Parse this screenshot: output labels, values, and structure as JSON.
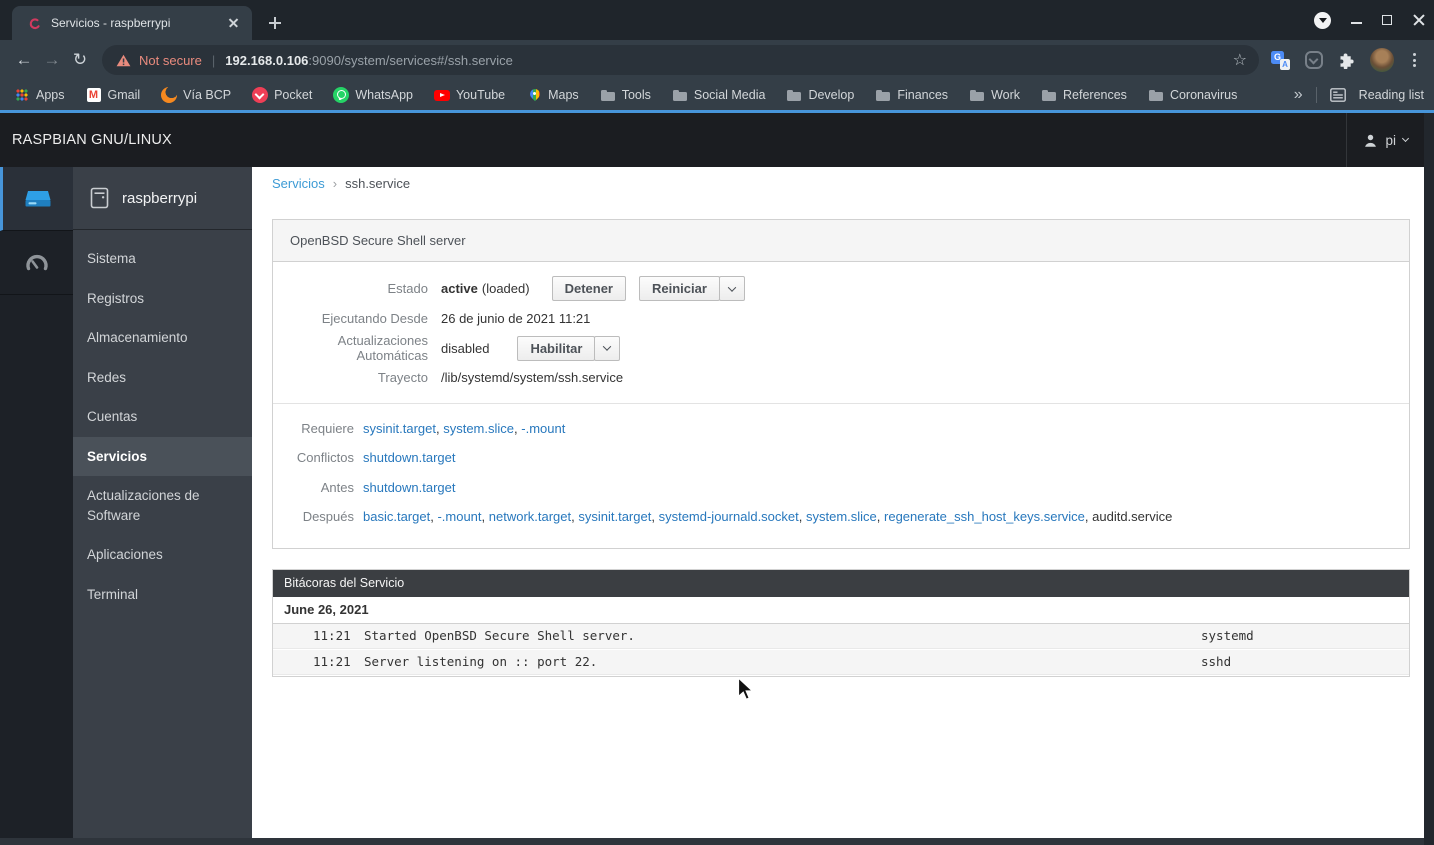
{
  "colors": {
    "accent": "#4795da",
    "link": "#2878bd",
    "crumb": "#3d9bd5",
    "notsecure": "#e98b7e",
    "frame": "#1f252b",
    "toolbar": "#343e47",
    "pill": "#2a323a",
    "topnav": "#1b1d21",
    "strip": "#1d2127",
    "sidebar": "#3a4048",
    "selected": "#4a5159",
    "logshead": "#3b3e42"
  },
  "browser": {
    "tab_title": "Servicios - raspberrypi",
    "security_label": "Not secure",
    "url_host": "192.168.0.106",
    "url_rest": ":9090/system/services#/ssh.service",
    "bookmarks": [
      {
        "label": "Apps",
        "icon": "apps"
      },
      {
        "label": "Gmail",
        "icon": "gmail"
      },
      {
        "label": "Vía BCP",
        "icon": "bcp"
      },
      {
        "label": "Pocket",
        "icon": "pocket"
      },
      {
        "label": "WhatsApp",
        "icon": "whatsapp"
      },
      {
        "label": "YouTube",
        "icon": "youtube"
      },
      {
        "label": "Maps",
        "icon": "maps"
      },
      {
        "label": "Tools",
        "icon": "folder"
      },
      {
        "label": "Social Media",
        "icon": "folder"
      },
      {
        "label": "Develop",
        "icon": "folder"
      },
      {
        "label": "Finances",
        "icon": "folder"
      },
      {
        "label": "Work",
        "icon": "folder"
      },
      {
        "label": "References",
        "icon": "folder"
      },
      {
        "label": "Coronavirus",
        "icon": "folder"
      }
    ],
    "reading_list_label": "Reading list"
  },
  "cockpit": {
    "brand": "RASPBIAN GNU/LINUX",
    "user": "pi",
    "hostname": "raspberrypi",
    "nav": [
      {
        "label": "Sistema"
      },
      {
        "label": "Registros"
      },
      {
        "label": "Almacenamiento"
      },
      {
        "label": "Redes"
      },
      {
        "label": "Cuentas"
      },
      {
        "label": "Servicios",
        "cls": "selected"
      },
      {
        "label": "Actualizaciones de Software"
      },
      {
        "label": "Aplicaciones"
      },
      {
        "label": "Terminal"
      }
    ]
  },
  "breadcrumb": {
    "parent": "Servicios",
    "divider": "›",
    "current": "ssh.service"
  },
  "service_card": {
    "title": "OpenBSD Secure Shell server",
    "status_label": "Estado",
    "status_state": "active",
    "status_detail": "(loaded)",
    "stop_button": "Detener",
    "restart_button": "Reiniciar",
    "since_label": "Ejecutando Desde",
    "since_value": "26 de junio de 2021 11:21",
    "updates_label": "Actualizaciones Automáticas",
    "updates_value": "disabled",
    "enable_button": "Habilitar",
    "path_label": "Trayecto",
    "path_value": "/lib/systemd/system/ssh.service",
    "relations": [
      {
        "label": "Requiere",
        "items": [
          {
            "text": "sysinit.target",
            "sep": ", ",
            "cls": "link"
          },
          {
            "text": "system.slice",
            "sep": ", ",
            "cls": "link"
          },
          {
            "text": "-.mount",
            "sep": "",
            "cls": "link"
          }
        ]
      },
      {
        "label": "Conflictos",
        "items": [
          {
            "text": "shutdown.target",
            "sep": "",
            "cls": "link"
          }
        ]
      },
      {
        "label": "Antes",
        "items": [
          {
            "text": "shutdown.target",
            "sep": "",
            "cls": "link"
          }
        ]
      },
      {
        "label": "Después",
        "items": [
          {
            "text": "basic.target",
            "sep": ", ",
            "cls": "link"
          },
          {
            "text": "-.mount",
            "sep": ", ",
            "cls": "link"
          },
          {
            "text": "network.target",
            "sep": ", ",
            "cls": "link"
          },
          {
            "text": "sysinit.target",
            "sep": ", ",
            "cls": "link"
          },
          {
            "text": "systemd-journald.socket",
            "sep": ", ",
            "cls": "link"
          },
          {
            "text": "system.slice",
            "sep": ", ",
            "cls": "link"
          },
          {
            "text": "regenerate_ssh_host_keys.service",
            "sep": ", ",
            "cls": "link"
          },
          {
            "text": "auditd.service",
            "sep": "",
            "cls": "plain"
          }
        ]
      }
    ]
  },
  "logs_card": {
    "title": "Bitácoras del Servicio",
    "date_header": "June 26, 2021",
    "entries": [
      {
        "time": "11:21",
        "message": "Started OpenBSD Secure Shell server.",
        "unit": "systemd"
      },
      {
        "time": "11:21",
        "message": "Server listening on :: port 22.",
        "unit": "sshd"
      }
    ]
  }
}
